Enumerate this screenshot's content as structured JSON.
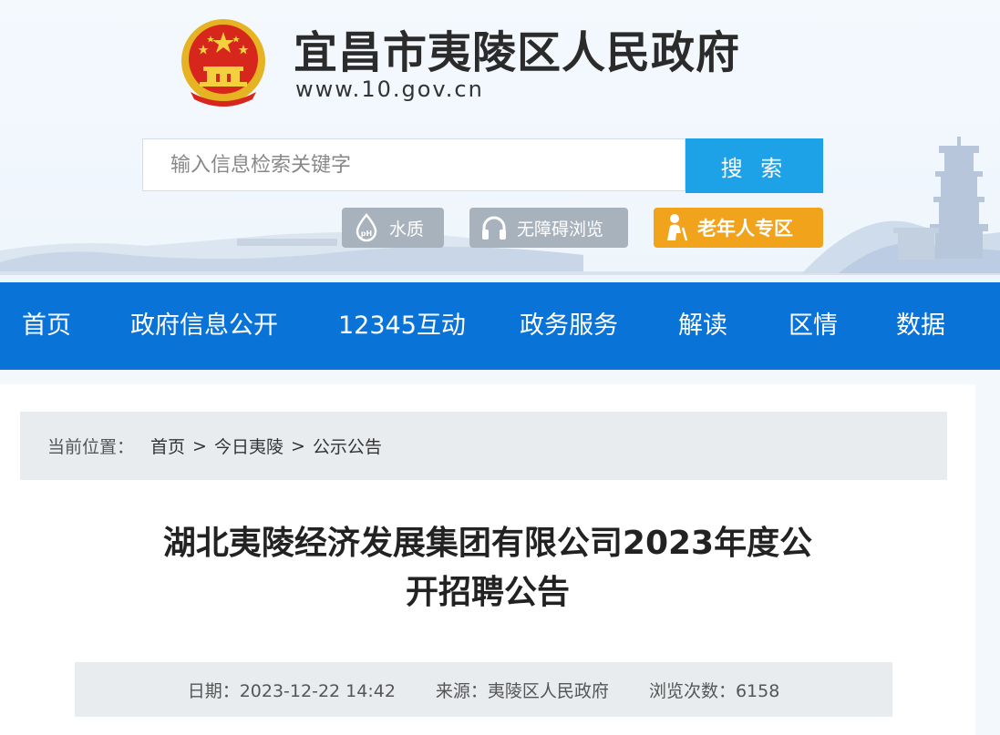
{
  "header": {
    "site_title": "宜昌市夷陵区人民政府",
    "site_url": "www.10.gov.cn",
    "search_placeholder": "输入信息检索关键字",
    "search_button": "搜 索",
    "tools": [
      {
        "label": "水质",
        "icon": "water-drop-icon"
      },
      {
        "label": "无障碍浏览",
        "icon": "headphones-icon"
      },
      {
        "label": "老年人专区",
        "icon": "elder-icon"
      }
    ]
  },
  "nav": {
    "items": [
      "首页",
      "政府信息公开",
      "12345互动",
      "政务服务",
      "解读",
      "区情",
      "数据"
    ]
  },
  "breadcrumb": {
    "label": "当前位置：",
    "items": [
      "首页",
      "今日夷陵",
      "公示公告"
    ],
    "separator": ">"
  },
  "article": {
    "title_line1": "湖北夷陵经济发展集团有限公司2023年度公",
    "title_line2": "开招聘公告",
    "date": "日期：2023-12-22 14:42",
    "source": "来源：夷陵区人民政府",
    "views": "浏览次数：6158"
  },
  "colors": {
    "nav_bg": "#0a73d8",
    "search_button": "#1da2e8",
    "elder_button": "#f0a31b",
    "tool_button": "#a8b2bd"
  }
}
